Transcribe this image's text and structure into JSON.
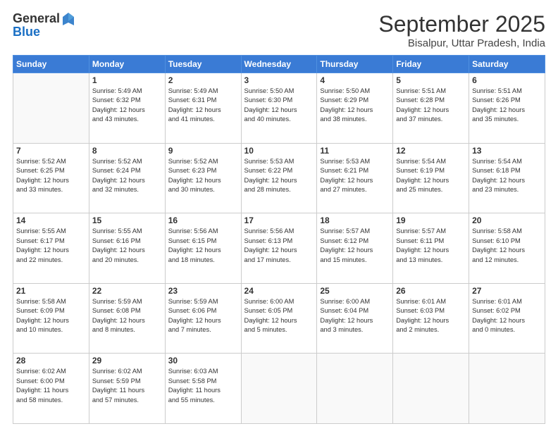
{
  "header": {
    "logo_general": "General",
    "logo_blue": "Blue",
    "month": "September 2025",
    "location": "Bisalpur, Uttar Pradesh, India"
  },
  "weekdays": [
    "Sunday",
    "Monday",
    "Tuesday",
    "Wednesday",
    "Thursday",
    "Friday",
    "Saturday"
  ],
  "weeks": [
    [
      {
        "day": "",
        "info": ""
      },
      {
        "day": "1",
        "info": "Sunrise: 5:49 AM\nSunset: 6:32 PM\nDaylight: 12 hours\nand 43 minutes."
      },
      {
        "day": "2",
        "info": "Sunrise: 5:49 AM\nSunset: 6:31 PM\nDaylight: 12 hours\nand 41 minutes."
      },
      {
        "day": "3",
        "info": "Sunrise: 5:50 AM\nSunset: 6:30 PM\nDaylight: 12 hours\nand 40 minutes."
      },
      {
        "day": "4",
        "info": "Sunrise: 5:50 AM\nSunset: 6:29 PM\nDaylight: 12 hours\nand 38 minutes."
      },
      {
        "day": "5",
        "info": "Sunrise: 5:51 AM\nSunset: 6:28 PM\nDaylight: 12 hours\nand 37 minutes."
      },
      {
        "day": "6",
        "info": "Sunrise: 5:51 AM\nSunset: 6:26 PM\nDaylight: 12 hours\nand 35 minutes."
      }
    ],
    [
      {
        "day": "7",
        "info": "Sunrise: 5:52 AM\nSunset: 6:25 PM\nDaylight: 12 hours\nand 33 minutes."
      },
      {
        "day": "8",
        "info": "Sunrise: 5:52 AM\nSunset: 6:24 PM\nDaylight: 12 hours\nand 32 minutes."
      },
      {
        "day": "9",
        "info": "Sunrise: 5:52 AM\nSunset: 6:23 PM\nDaylight: 12 hours\nand 30 minutes."
      },
      {
        "day": "10",
        "info": "Sunrise: 5:53 AM\nSunset: 6:22 PM\nDaylight: 12 hours\nand 28 minutes."
      },
      {
        "day": "11",
        "info": "Sunrise: 5:53 AM\nSunset: 6:21 PM\nDaylight: 12 hours\nand 27 minutes."
      },
      {
        "day": "12",
        "info": "Sunrise: 5:54 AM\nSunset: 6:19 PM\nDaylight: 12 hours\nand 25 minutes."
      },
      {
        "day": "13",
        "info": "Sunrise: 5:54 AM\nSunset: 6:18 PM\nDaylight: 12 hours\nand 23 minutes."
      }
    ],
    [
      {
        "day": "14",
        "info": "Sunrise: 5:55 AM\nSunset: 6:17 PM\nDaylight: 12 hours\nand 22 minutes."
      },
      {
        "day": "15",
        "info": "Sunrise: 5:55 AM\nSunset: 6:16 PM\nDaylight: 12 hours\nand 20 minutes."
      },
      {
        "day": "16",
        "info": "Sunrise: 5:56 AM\nSunset: 6:15 PM\nDaylight: 12 hours\nand 18 minutes."
      },
      {
        "day": "17",
        "info": "Sunrise: 5:56 AM\nSunset: 6:13 PM\nDaylight: 12 hours\nand 17 minutes."
      },
      {
        "day": "18",
        "info": "Sunrise: 5:57 AM\nSunset: 6:12 PM\nDaylight: 12 hours\nand 15 minutes."
      },
      {
        "day": "19",
        "info": "Sunrise: 5:57 AM\nSunset: 6:11 PM\nDaylight: 12 hours\nand 13 minutes."
      },
      {
        "day": "20",
        "info": "Sunrise: 5:58 AM\nSunset: 6:10 PM\nDaylight: 12 hours\nand 12 minutes."
      }
    ],
    [
      {
        "day": "21",
        "info": "Sunrise: 5:58 AM\nSunset: 6:09 PM\nDaylight: 12 hours\nand 10 minutes."
      },
      {
        "day": "22",
        "info": "Sunrise: 5:59 AM\nSunset: 6:08 PM\nDaylight: 12 hours\nand 8 minutes."
      },
      {
        "day": "23",
        "info": "Sunrise: 5:59 AM\nSunset: 6:06 PM\nDaylight: 12 hours\nand 7 minutes."
      },
      {
        "day": "24",
        "info": "Sunrise: 6:00 AM\nSunset: 6:05 PM\nDaylight: 12 hours\nand 5 minutes."
      },
      {
        "day": "25",
        "info": "Sunrise: 6:00 AM\nSunset: 6:04 PM\nDaylight: 12 hours\nand 3 minutes."
      },
      {
        "day": "26",
        "info": "Sunrise: 6:01 AM\nSunset: 6:03 PM\nDaylight: 12 hours\nand 2 minutes."
      },
      {
        "day": "27",
        "info": "Sunrise: 6:01 AM\nSunset: 6:02 PM\nDaylight: 12 hours\nand 0 minutes."
      }
    ],
    [
      {
        "day": "28",
        "info": "Sunrise: 6:02 AM\nSunset: 6:00 PM\nDaylight: 11 hours\nand 58 minutes."
      },
      {
        "day": "29",
        "info": "Sunrise: 6:02 AM\nSunset: 5:59 PM\nDaylight: 11 hours\nand 57 minutes."
      },
      {
        "day": "30",
        "info": "Sunrise: 6:03 AM\nSunset: 5:58 PM\nDaylight: 11 hours\nand 55 minutes."
      },
      {
        "day": "",
        "info": ""
      },
      {
        "day": "",
        "info": ""
      },
      {
        "day": "",
        "info": ""
      },
      {
        "day": "",
        "info": ""
      }
    ]
  ]
}
